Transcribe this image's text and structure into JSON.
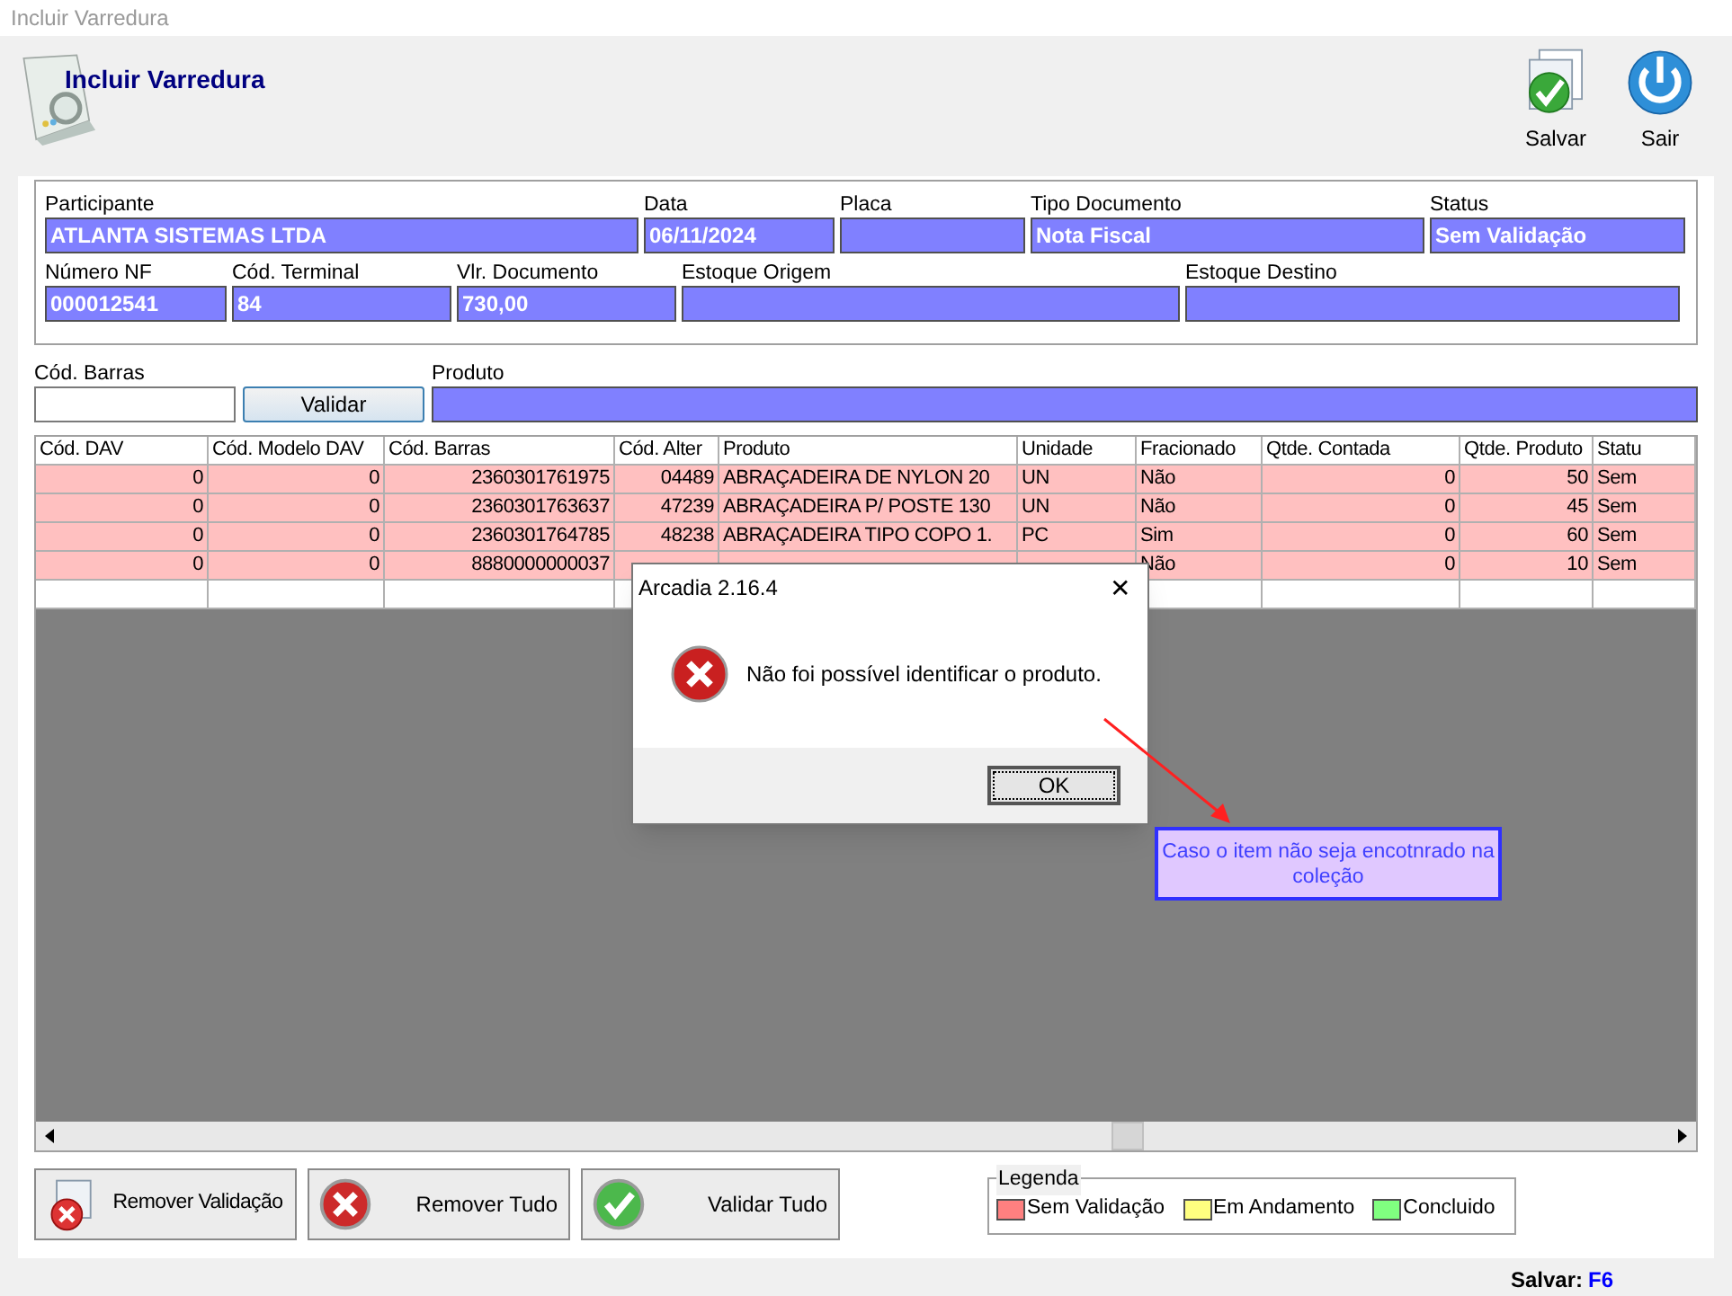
{
  "window": {
    "title": "Incluir Varredura"
  },
  "header": {
    "title": "Incluir Varredura",
    "actions": [
      {
        "kind": "save",
        "label": "Salvar"
      },
      {
        "kind": "exit",
        "label": "Sair"
      }
    ]
  },
  "fields_row_1": [
    {
      "label": "Participante",
      "value": "ATLANTA SISTEMAS LTDA"
    },
    {
      "label": "Data",
      "value": "06/11/2024"
    },
    {
      "label": "Placa"
    },
    {
      "label": "Tipo Documento",
      "value": "Nota Fiscal"
    },
    {
      "label": "Status",
      "value": "Sem Validação"
    }
  ],
  "fields_row_2": [
    {
      "label": "Número NF",
      "value": "000012541"
    },
    {
      "label": "Cód. Terminal",
      "value": "84"
    },
    {
      "label": "Vlr. Documento",
      "value": "730,00"
    },
    {
      "label": "Estoque Origem"
    },
    {
      "label": "Estoque Destino"
    }
  ],
  "barcode": {
    "label": "Cód. Barras",
    "button": "Validar",
    "product_label": "Produto"
  },
  "table": {
    "columns": [
      "Cód. DAV",
      "Cód. Modelo DAV",
      "Cód. Barras",
      "Cód. Alter",
      "Produto",
      "Unidade",
      "Fracionado",
      "Qtde. Contada",
      "Qtde. Produto",
      "Statu"
    ],
    "rows": [
      {
        "color": "#ffc0c0",
        "cells": [
          "0",
          "0",
          "2360301761975",
          "04489",
          "ABRAÇADEIRA DE NYLON 20",
          "UN",
          "Não",
          "0",
          "50",
          "Sem"
        ]
      },
      {
        "color": "#ffc0c0",
        "cells": [
          "0",
          "0",
          "2360301763637",
          "47239",
          "ABRAÇADEIRA P/ POSTE 130",
          "UN",
          "Não",
          "0",
          "45",
          "Sem"
        ]
      },
      {
        "color": "#ffc0c0",
        "cells": [
          "0",
          "0",
          "2360301764785",
          "48238",
          "ABRAÇADEIRA TIPO COPO 1.",
          "PC",
          "Sim",
          "0",
          "60",
          "Sem"
        ]
      },
      {
        "color": "#ffc0c0",
        "cells": [
          "0",
          "0",
          "8880000000037",
          "",
          "",
          "",
          "Não",
          "0",
          "10",
          "Sem"
        ]
      }
    ]
  },
  "buttons": [
    {
      "kind": "remove-validation",
      "label": "Remover Validação"
    },
    {
      "kind": "remove-all",
      "label": "Remover Tudo"
    },
    {
      "kind": "validate-all",
      "label": "Validar Tudo"
    }
  ],
  "legend": {
    "title": "Legenda",
    "items": [
      {
        "label": "Sem Validação",
        "color": "#ff8080"
      },
      {
        "label": "Em Andamento",
        "color": "#ffff80"
      },
      {
        "label": "Concluido",
        "color": "#80ff80"
      }
    ]
  },
  "status_bar": {
    "label": "Salvar:",
    "key": "F6"
  },
  "dialog": {
    "title": "Arcadia 2.16.4",
    "close": "✕",
    "message": "Não foi possível identificar o produto.",
    "button": "OK"
  },
  "annotation": {
    "text": "Caso o item não seja encotnrado na coleção"
  }
}
